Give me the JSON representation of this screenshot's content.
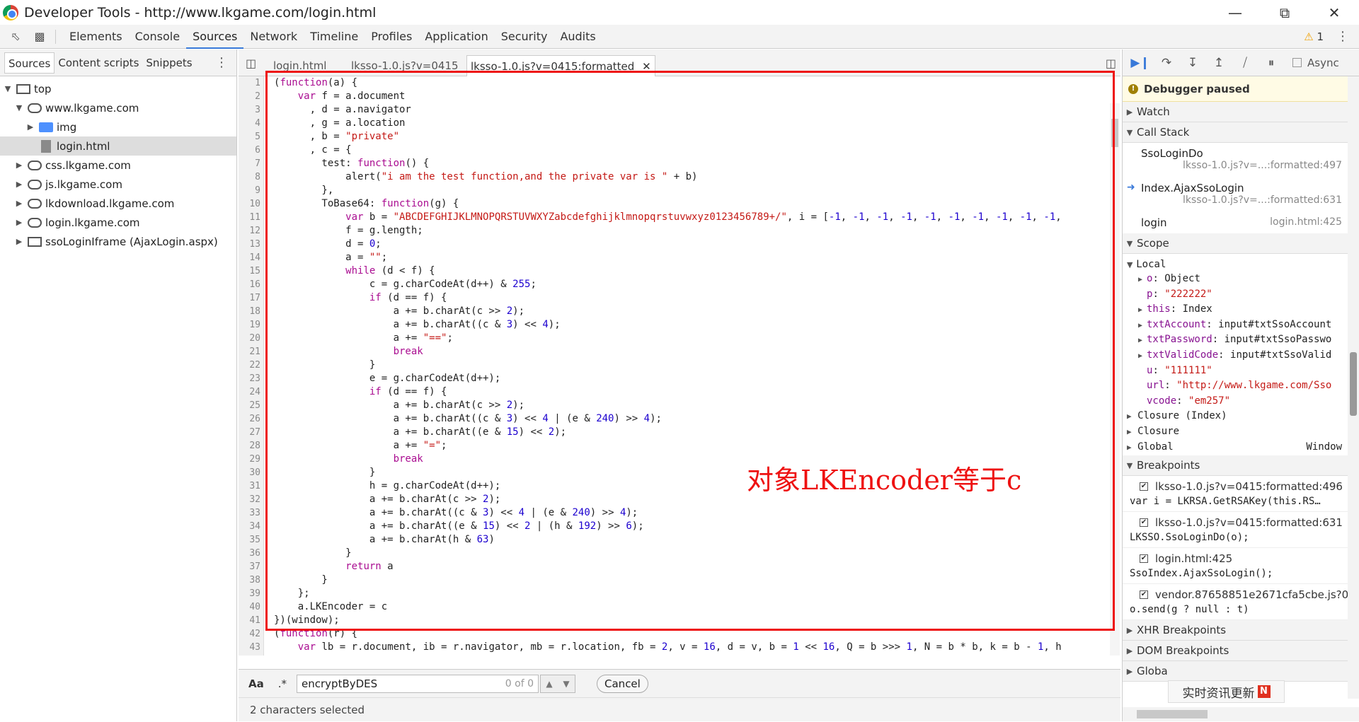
{
  "window": {
    "title": "Developer Tools - http://www.lkgame.com/login.html"
  },
  "toolbar": {
    "tabs": [
      "Elements",
      "Console",
      "Sources",
      "Network",
      "Timeline",
      "Profiles",
      "Application",
      "Security",
      "Audits"
    ],
    "active_tab": "Sources",
    "warning_count": "1"
  },
  "navigator": {
    "tabs": [
      "Sources",
      "Content scripts",
      "Snippets"
    ],
    "tree": {
      "top": "top",
      "domain1": "www.lkgame.com",
      "img": "img",
      "file": "login.html",
      "css": "css.lkgame.com",
      "js": "js.lkgame.com",
      "dl": "lkdownload.lkgame.com",
      "login": "login.lkgame.com",
      "iframe": "ssoLoginIframe (AjaxLogin.aspx)"
    }
  },
  "editor": {
    "tabs": [
      "login.html",
      "lksso-1.0.js?v=0415",
      "lksso-1.0.js?v=0415:formatted"
    ],
    "annotation": "对象LKEncoder等于c",
    "search_value": "encryptByDES",
    "search_count": "0 of 0",
    "cancel_label": "Cancel",
    "aa_label": "Aa",
    "regex_label": ".*",
    "status": "2 characters selected",
    "lines": [
      "(function(a) {",
      "    var f = a.document",
      "      , d = a.navigator",
      "      , g = a.location",
      "      , b = \"private\"",
      "      , c = {",
      "        test: function() {",
      "            alert(\"i am the test function,and the private var is \" + b)",
      "        },",
      "        ToBase64: function(g) {",
      "            var b = \"ABCDEFGHIJKLMNOPQRSTUVWXYZabcdefghijklmnopqrstuvwxyz0123456789+/\", i = [-1, -1, -1, -1, -1, -1, -1, -1, -1, -1,",
      "            f = g.length;",
      "            d = 0;",
      "            a = \"\";",
      "            while (d < f) {",
      "                c = g.charCodeAt(d++) & 255;",
      "                if (d == f) {",
      "                    a += b.charAt(c >> 2);",
      "                    a += b.charAt((c & 3) << 4);",
      "                    a += \"==\";",
      "                    break",
      "                }",
      "                e = g.charCodeAt(d++);",
      "                if (d == f) {",
      "                    a += b.charAt(c >> 2);",
      "                    a += b.charAt((c & 3) << 4 | (e & 240) >> 4);",
      "                    a += b.charAt((e & 15) << 2);",
      "                    a += \"=\";",
      "                    break",
      "                }",
      "                h = g.charCodeAt(d++);",
      "                a += b.charAt(c >> 2);",
      "                a += b.charAt((c & 3) << 4 | (e & 240) >> 4);",
      "                a += b.charAt((e & 15) << 2 | (h & 192) >> 6);",
      "                a += b.charAt(h & 63)",
      "            }",
      "            return a",
      "        }",
      "    };",
      "    a.LKEncoder = c",
      "})(window);",
      "(function(r) {",
      "    var lb = r.document, ib = r.navigator, mb = r.location, fb = 2, v = 16, d = v, b = 1 << 16, Q = b >>> 1, N = b * b, k = b - 1, h",
      ""
    ]
  },
  "debugger": {
    "async_label": "Async",
    "paused_label": "Debugger paused",
    "watch_label": "Watch",
    "callstack_label": "Call Stack",
    "callstack": [
      {
        "fn": "SsoLoginDo",
        "loc": "lksso-1.0.js?v=...:formatted:497"
      },
      {
        "fn": "Index.AjaxSsoLogin",
        "loc": "lksso-1.0.js?v=...:formatted:631"
      },
      {
        "fn": "login",
        "loc": "login.html:425"
      }
    ],
    "scope_label": "Scope",
    "local_label": "Local",
    "scope_vars": [
      {
        "k": "o",
        "v": "Object",
        "expand": true
      },
      {
        "k": "p",
        "v": "\"222222\"",
        "expand": false
      },
      {
        "k": "this",
        "v": "Index",
        "expand": true
      },
      {
        "k": "txtAccount",
        "v": "input#txtSsoAccount",
        "expand": true
      },
      {
        "k": "txtPassword",
        "v": "input#txtSsoPasswo",
        "expand": true
      },
      {
        "k": "txtValidCode",
        "v": "input#txtSsoValid",
        "expand": true
      },
      {
        "k": "u",
        "v": "\"111111\"",
        "expand": false
      },
      {
        "k": "url",
        "v": "\"http://www.lkgame.com/Sso",
        "expand": false
      },
      {
        "k": "vcode",
        "v": "\"em257\"",
        "expand": false
      }
    ],
    "closure_index": "Closure (Index)",
    "closure": "Closure",
    "global": "Global",
    "global_val": "Window",
    "breakpoints_label": "Breakpoints",
    "breakpoints": [
      {
        "loc": "lksso-1.0.js?v=0415:formatted:496",
        "code": "var i = LKRSA.GetRSAKey(this.RS…"
      },
      {
        "loc": "lksso-1.0.js?v=0415:formatted:631",
        "code": "LKSSO.SsoLoginDo(o);"
      },
      {
        "loc": "login.html:425",
        "code": "SsoIndex.AjaxSsoLogin();"
      },
      {
        "loc": "vendor.87658851e2671cfa5cbe.js?0..",
        "code": "o.send(g ? null : t)"
      }
    ],
    "xhr_label": "XHR Breakpoints",
    "dom_label": "DOM Breakpoints",
    "global_listeners_label": "Globa",
    "watermark": "实时资讯更新",
    "watermark_badge": "N"
  }
}
